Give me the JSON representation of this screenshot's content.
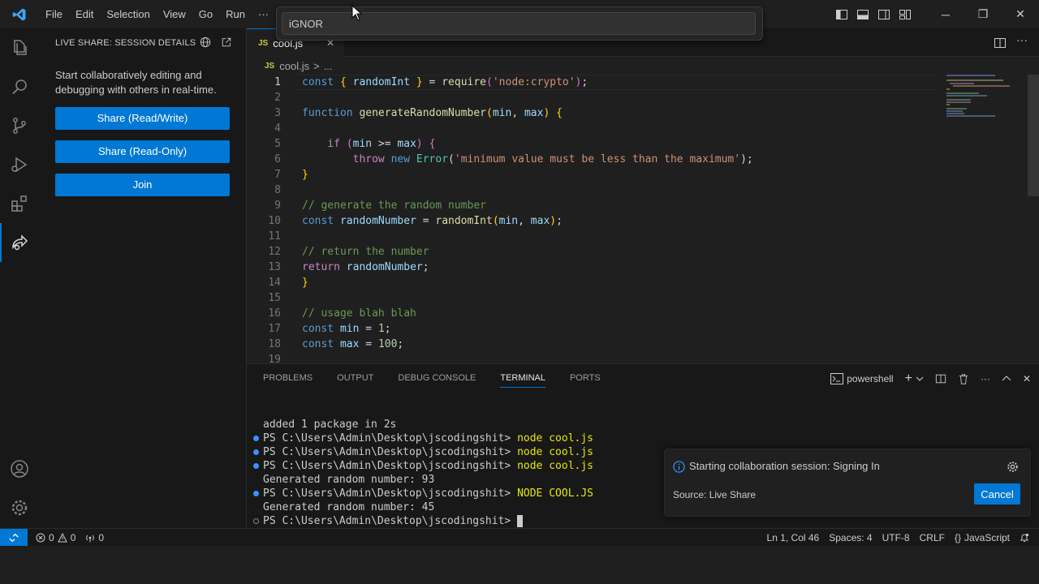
{
  "menu": [
    "File",
    "Edit",
    "Selection",
    "View",
    "Go",
    "Run",
    "···"
  ],
  "command_palette": {
    "value": "iGNOR"
  },
  "window_controls": {
    "minimize": "─",
    "restore": "❐",
    "close": "✕"
  },
  "sidebar": {
    "title": "LIVE SHARE: SESSION DETAILS",
    "description": "Start collaboratively editing and debugging with others in real-time.",
    "buttons": [
      "Share (Read/Write)",
      "Share (Read-Only)",
      "Join"
    ]
  },
  "editor": {
    "tab": {
      "icon": "JS",
      "label": "cool.js",
      "close": "✕"
    },
    "breadcrumb": {
      "icon": "JS",
      "file": "cool.js",
      "sep": ">",
      "rest": "..."
    },
    "line_numbers": [
      "1",
      "2",
      "3",
      "4",
      "5",
      "6",
      "7",
      "8",
      "9",
      "10",
      "11",
      "12",
      "13",
      "14",
      "15",
      "16",
      "17",
      "18",
      "19"
    ],
    "lines": [
      [
        [
          "k",
          "const "
        ],
        [
          "b1",
          "{ "
        ],
        [
          "v",
          "randomInt"
        ],
        [
          "b1",
          " }"
        ],
        [
          "p",
          " = "
        ],
        [
          "f",
          "require"
        ],
        [
          "b2",
          "("
        ],
        [
          "s",
          "'node:crypto'"
        ],
        [
          "b2",
          ")"
        ],
        [
          "p",
          ";"
        ]
      ],
      [],
      [
        [
          "k",
          "function "
        ],
        [
          "f",
          "generateRandomNumber"
        ],
        [
          "b1",
          "("
        ],
        [
          "v",
          "min"
        ],
        [
          "p",
          ", "
        ],
        [
          "v",
          "max"
        ],
        [
          "b1",
          ")"
        ],
        [
          "p",
          " "
        ],
        [
          "b1",
          "{"
        ]
      ],
      [],
      [
        [
          "p",
          "    "
        ],
        [
          "c",
          "if "
        ],
        [
          "b2",
          "("
        ],
        [
          "v",
          "min"
        ],
        [
          "p",
          " >= "
        ],
        [
          "v",
          "max"
        ],
        [
          "b2",
          ")"
        ],
        [
          "p",
          " "
        ],
        [
          "b2",
          "{"
        ]
      ],
      [
        [
          "p",
          "        "
        ],
        [
          "c",
          "throw "
        ],
        [
          "k",
          "new "
        ],
        [
          "t",
          "Error"
        ],
        [
          "p",
          "("
        ],
        [
          "s",
          "'minimum value must be less than the maximum'"
        ],
        [
          "p",
          ");"
        ]
      ],
      [
        [
          "b1",
          "}"
        ]
      ],
      [],
      [
        [
          "cm",
          "// generate the random number"
        ]
      ],
      [
        [
          "k",
          "const "
        ],
        [
          "v",
          "randomNumber"
        ],
        [
          "p",
          " = "
        ],
        [
          "f",
          "randomInt"
        ],
        [
          "b1",
          "("
        ],
        [
          "v",
          "min"
        ],
        [
          "p",
          ", "
        ],
        [
          "v",
          "max"
        ],
        [
          "b1",
          ")"
        ],
        [
          "p",
          ";"
        ]
      ],
      [],
      [
        [
          "cm",
          "// return the number"
        ]
      ],
      [
        [
          "c",
          "return "
        ],
        [
          "v",
          "randomNumber"
        ],
        [
          "p",
          ";"
        ]
      ],
      [
        [
          "b1",
          "}"
        ]
      ],
      [],
      [
        [
          "cm",
          "// usage blah blah"
        ]
      ],
      [
        [
          "k",
          "const "
        ],
        [
          "v",
          "min"
        ],
        [
          "p",
          " = "
        ],
        [
          "n",
          "1"
        ],
        [
          "p",
          ";"
        ]
      ],
      [
        [
          "k",
          "const "
        ],
        [
          "v",
          "max"
        ],
        [
          "p",
          " = "
        ],
        [
          "n",
          "100"
        ],
        [
          "p",
          ";"
        ]
      ],
      []
    ]
  },
  "panel": {
    "tabs": [
      "PROBLEMS",
      "OUTPUT",
      "DEBUG CONSOLE",
      "TERMINAL",
      "PORTS"
    ],
    "active_tab": "TERMINAL",
    "shell": "powershell",
    "terminal_lines": [
      {
        "prompt": "",
        "text": "added 1 package in 2s",
        "dot": "none"
      },
      {
        "prompt": "PS C:\\Users\\Admin\\Desktop\\jscodingshit> ",
        "text": "node cool.js",
        "dot": "blue"
      },
      {
        "prompt": "PS C:\\Users\\Admin\\Desktop\\jscodingshit> ",
        "text": "node cool.js",
        "dot": "blue"
      },
      {
        "prompt": "PS C:\\Users\\Admin\\Desktop\\jscodingshit> ",
        "text": "node cool.js",
        "dot": "blue"
      },
      {
        "prompt": "",
        "text": "Generated random number: 93",
        "dot": "none"
      },
      {
        "prompt": "PS C:\\Users\\Admin\\Desktop\\jscodingshit> ",
        "text": "NODE COOL.JS",
        "dot": "blue"
      },
      {
        "prompt": "",
        "text": "Generated random number: 45",
        "dot": "none"
      },
      {
        "prompt": "PS C:\\Users\\Admin\\Desktop\\jscodingshit> ",
        "text": "",
        "dot": "hollow"
      }
    ]
  },
  "notification": {
    "message": "Starting collaboration session: Signing In",
    "source": "Source: Live Share",
    "button": "Cancel"
  },
  "statusbar": {
    "errors": "0",
    "warnings": "0",
    "ports": "0",
    "position": "Ln 1, Col 46",
    "spaces": "Spaces: 4",
    "encoding": "UTF-8",
    "eol": "CRLF",
    "language": "JavaScript"
  },
  "colors": {
    "accent": "#0078d4",
    "background": "#1f1f1f"
  }
}
